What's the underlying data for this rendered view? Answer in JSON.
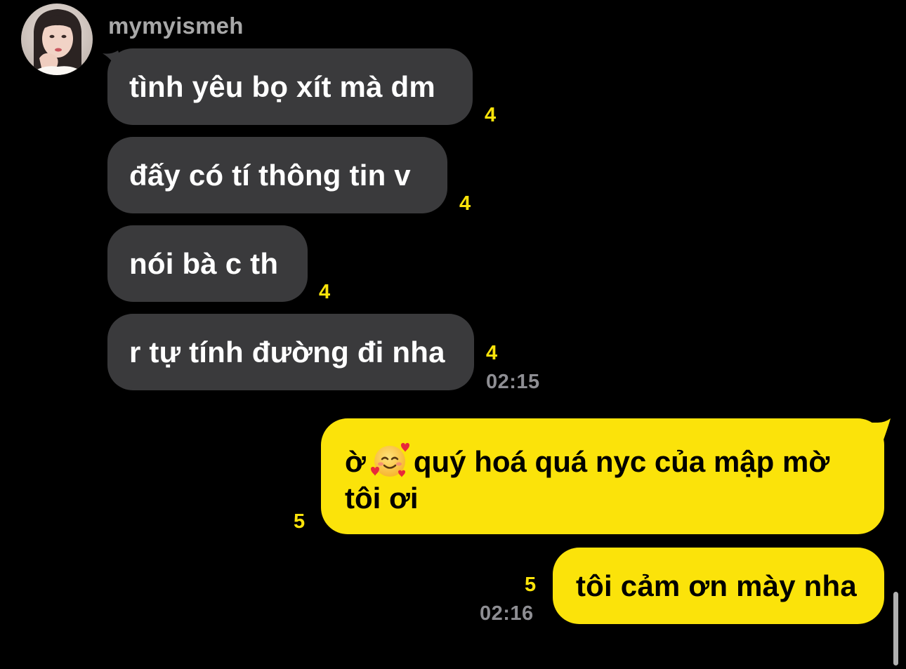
{
  "chat": {
    "sender_name": "mymyismeh",
    "avatar_icon": "profile-photo",
    "messages": [
      {
        "direction": "incoming",
        "text": "tình yêu bọ xít mà dm",
        "unread_count": "4"
      },
      {
        "direction": "incoming",
        "text": "đấy có tí thông tin v",
        "unread_count": "4"
      },
      {
        "direction": "incoming",
        "text": "nói bà c th",
        "unread_count": "4"
      },
      {
        "direction": "incoming",
        "text": "r tự tính đường đi nha",
        "unread_count": "4",
        "time": "02:15"
      },
      {
        "direction": "outgoing",
        "text_before_emoji": "ờ",
        "emoji": "smiling-face-with-hearts",
        "text_after_emoji": "quý hoá quá nyc của mập mờ",
        "text_line2": "tôi ơi",
        "unread_count": "5"
      },
      {
        "direction": "outgoing",
        "text": "tôi cảm ơn mày nha",
        "unread_count": "5",
        "time": "02:16"
      }
    ]
  },
  "colors": {
    "background": "#000000",
    "incoming_bubble": "#3a3a3c",
    "outgoing_bubble": "#fbe30a",
    "unread_count": "#fbe30a",
    "timestamp": "#8e8e93",
    "sender_name": "#a8a8a8"
  }
}
